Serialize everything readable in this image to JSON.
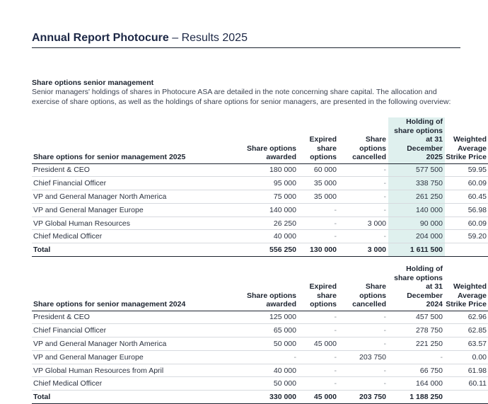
{
  "header": {
    "title_bold": "Annual Report Photocure",
    "title_rest": " – Results 2025"
  },
  "section": {
    "heading": "Share options senior management",
    "intro": "Senior managers' holdings of shares in Photocure ASA are detailed in the note concerning share capital. The allocation and exercise of share options, as well as the holdings of share options for senior managers, are presented in the following overview:"
  },
  "highlight_color": "#dff0ee",
  "table_2025": {
    "headers": [
      "Share options for senior management 2025",
      "Share options awarded",
      "Expired share options",
      "Share options cancelled",
      "Holding of share options at 31 December 2025",
      "Weighted Average Strike Price"
    ],
    "rows": [
      [
        "President & CEO",
        "180 000",
        "60 000",
        "-",
        "577 500",
        "59.95"
      ],
      [
        "Chief Financial Officer",
        "95 000",
        "35 000",
        "-",
        "338 750",
        "60.09"
      ],
      [
        "VP and General Manager North America",
        "75 000",
        "35 000",
        "-",
        "261 250",
        "60.45"
      ],
      [
        "VP and General Manager Europe",
        "140 000",
        "-",
        "-",
        "140 000",
        "56.98"
      ],
      [
        "VP Global Human Resources",
        "26 250",
        "-",
        "3 000",
        "90 000",
        "60.09"
      ],
      [
        "Chief Medical Officer",
        "40 000",
        "-",
        "-",
        "204 000",
        "59.20"
      ]
    ],
    "total": [
      "Total",
      "556 250",
      "130 000",
      "3 000",
      "1 611 500",
      ""
    ]
  },
  "table_2024": {
    "headers": [
      "Share options for senior management 2024",
      "Share options awarded",
      "Expired share options",
      "Share options cancelled",
      "Holding of share options at 31 December 2024",
      "Weighted Average Strike Price"
    ],
    "rows": [
      [
        "President & CEO",
        "125 000",
        "-",
        "-",
        "457 500",
        "62.96"
      ],
      [
        "Chief Financial Officer",
        "65 000",
        "-",
        "-",
        "278 750",
        "62.85"
      ],
      [
        "VP and General Manager North America",
        "50 000",
        "45 000",
        "-",
        "221 250",
        "63.57"
      ],
      [
        "VP and General Manager Europe",
        "-",
        "-",
        "203 750",
        "-",
        "0.00"
      ],
      [
        "VP Global Human Resources from April",
        "40 000",
        "-",
        "-",
        "66 750",
        "61.98"
      ],
      [
        "Chief Medical Officer",
        "50 000",
        "-",
        "-",
        "164 000",
        "60.11"
      ]
    ],
    "total": [
      "Total",
      "330 000",
      "45 000",
      "203 750",
      "1 188 250",
      ""
    ]
  }
}
